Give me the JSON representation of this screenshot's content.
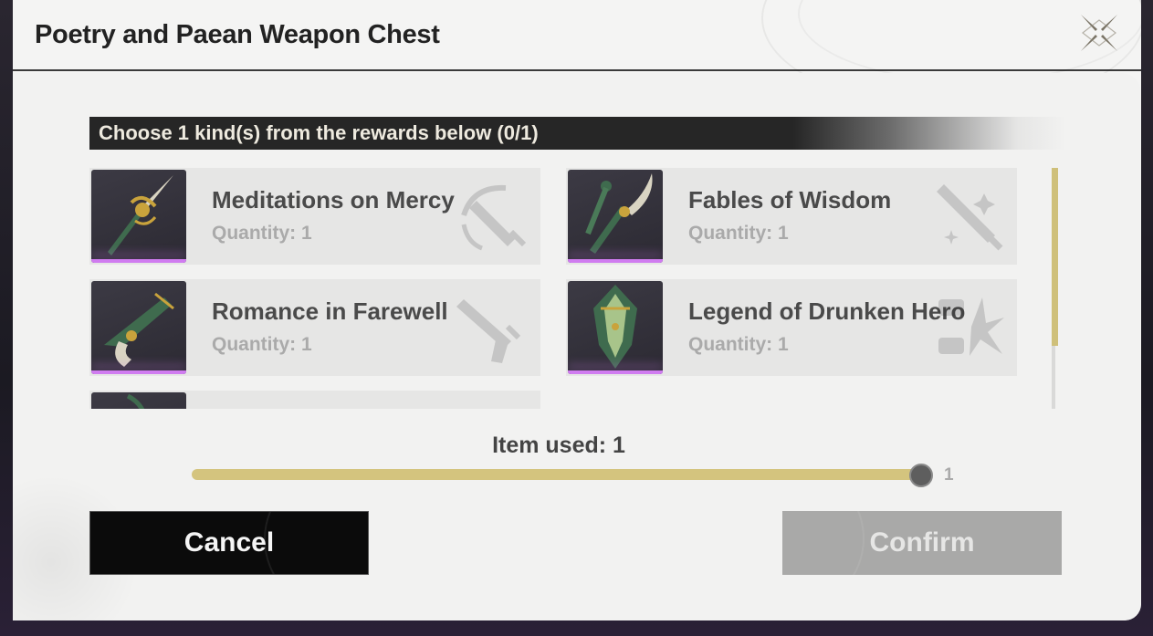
{
  "dialog": {
    "title": "Poetry and Paean Weapon Chest",
    "close_icon": "close-x-icon"
  },
  "instruction": "Choose 1 kind(s) from the rewards below (0/1)",
  "rewards": [
    {
      "name": "Meditations on Mercy",
      "quantity": "Quantity: 1",
      "weapon_type_icon": "broadblade-icon",
      "rarity_color": "#d07cf0"
    },
    {
      "name": "Fables of Wisdom",
      "quantity": "Quantity: 1",
      "weapon_type_icon": "sword-icon",
      "rarity_color": "#d07cf0"
    },
    {
      "name": "Romance in Farewell",
      "quantity": "Quantity: 1",
      "weapon_type_icon": "pistol-icon",
      "rarity_color": "#d07cf0"
    },
    {
      "name": "Legend of Drunken Hero",
      "quantity": "Quantity: 1",
      "weapon_type_icon": "gauntlets-icon",
      "rarity_color": "#d07cf0"
    },
    {
      "name": "",
      "quantity": "",
      "weapon_type_icon": "rectifier-icon",
      "rarity_color": "#d07cf0"
    }
  ],
  "slider": {
    "label": "Item used: 1",
    "value": 1,
    "max": 1,
    "max_label": "1"
  },
  "buttons": {
    "cancel": "Cancel",
    "confirm": "Confirm"
  },
  "colors": {
    "accent_gold": "#d4c47e",
    "rarity_purple": "#d07cf0",
    "confirm_disabled": "#a9a9a8"
  }
}
